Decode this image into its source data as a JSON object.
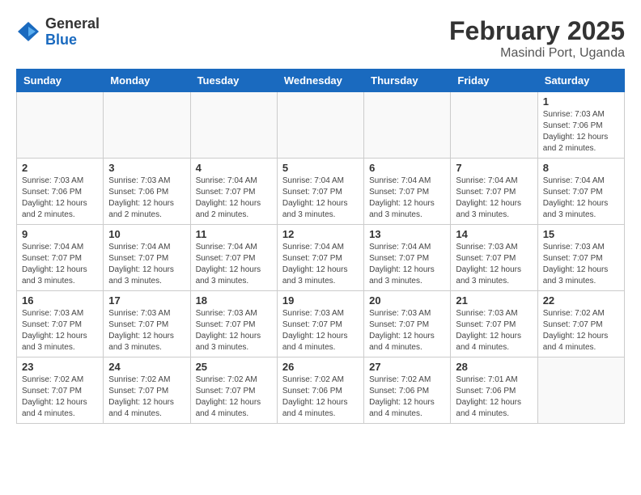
{
  "header": {
    "logo_general": "General",
    "logo_blue": "Blue",
    "title": "February 2025",
    "subtitle": "Masindi Port, Uganda"
  },
  "weekdays": [
    "Sunday",
    "Monday",
    "Tuesday",
    "Wednesday",
    "Thursday",
    "Friday",
    "Saturday"
  ],
  "weeks": [
    [
      {
        "day": null,
        "info": null
      },
      {
        "day": null,
        "info": null
      },
      {
        "day": null,
        "info": null
      },
      {
        "day": null,
        "info": null
      },
      {
        "day": null,
        "info": null
      },
      {
        "day": null,
        "info": null
      },
      {
        "day": "1",
        "info": "Sunrise: 7:03 AM\nSunset: 7:06 PM\nDaylight: 12 hours\nand 2 minutes."
      }
    ],
    [
      {
        "day": "2",
        "info": "Sunrise: 7:03 AM\nSunset: 7:06 PM\nDaylight: 12 hours\nand 2 minutes."
      },
      {
        "day": "3",
        "info": "Sunrise: 7:03 AM\nSunset: 7:06 PM\nDaylight: 12 hours\nand 2 minutes."
      },
      {
        "day": "4",
        "info": "Sunrise: 7:04 AM\nSunset: 7:07 PM\nDaylight: 12 hours\nand 2 minutes."
      },
      {
        "day": "5",
        "info": "Sunrise: 7:04 AM\nSunset: 7:07 PM\nDaylight: 12 hours\nand 3 minutes."
      },
      {
        "day": "6",
        "info": "Sunrise: 7:04 AM\nSunset: 7:07 PM\nDaylight: 12 hours\nand 3 minutes."
      },
      {
        "day": "7",
        "info": "Sunrise: 7:04 AM\nSunset: 7:07 PM\nDaylight: 12 hours\nand 3 minutes."
      },
      {
        "day": "8",
        "info": "Sunrise: 7:04 AM\nSunset: 7:07 PM\nDaylight: 12 hours\nand 3 minutes."
      }
    ],
    [
      {
        "day": "9",
        "info": "Sunrise: 7:04 AM\nSunset: 7:07 PM\nDaylight: 12 hours\nand 3 minutes."
      },
      {
        "day": "10",
        "info": "Sunrise: 7:04 AM\nSunset: 7:07 PM\nDaylight: 12 hours\nand 3 minutes."
      },
      {
        "day": "11",
        "info": "Sunrise: 7:04 AM\nSunset: 7:07 PM\nDaylight: 12 hours\nand 3 minutes."
      },
      {
        "day": "12",
        "info": "Sunrise: 7:04 AM\nSunset: 7:07 PM\nDaylight: 12 hours\nand 3 minutes."
      },
      {
        "day": "13",
        "info": "Sunrise: 7:04 AM\nSunset: 7:07 PM\nDaylight: 12 hours\nand 3 minutes."
      },
      {
        "day": "14",
        "info": "Sunrise: 7:03 AM\nSunset: 7:07 PM\nDaylight: 12 hours\nand 3 minutes."
      },
      {
        "day": "15",
        "info": "Sunrise: 7:03 AM\nSunset: 7:07 PM\nDaylight: 12 hours\nand 3 minutes."
      }
    ],
    [
      {
        "day": "16",
        "info": "Sunrise: 7:03 AM\nSunset: 7:07 PM\nDaylight: 12 hours\nand 3 minutes."
      },
      {
        "day": "17",
        "info": "Sunrise: 7:03 AM\nSunset: 7:07 PM\nDaylight: 12 hours\nand 3 minutes."
      },
      {
        "day": "18",
        "info": "Sunrise: 7:03 AM\nSunset: 7:07 PM\nDaylight: 12 hours\nand 3 minutes."
      },
      {
        "day": "19",
        "info": "Sunrise: 7:03 AM\nSunset: 7:07 PM\nDaylight: 12 hours\nand 4 minutes."
      },
      {
        "day": "20",
        "info": "Sunrise: 7:03 AM\nSunset: 7:07 PM\nDaylight: 12 hours\nand 4 minutes."
      },
      {
        "day": "21",
        "info": "Sunrise: 7:03 AM\nSunset: 7:07 PM\nDaylight: 12 hours\nand 4 minutes."
      },
      {
        "day": "22",
        "info": "Sunrise: 7:02 AM\nSunset: 7:07 PM\nDaylight: 12 hours\nand 4 minutes."
      }
    ],
    [
      {
        "day": "23",
        "info": "Sunrise: 7:02 AM\nSunset: 7:07 PM\nDaylight: 12 hours\nand 4 minutes."
      },
      {
        "day": "24",
        "info": "Sunrise: 7:02 AM\nSunset: 7:07 PM\nDaylight: 12 hours\nand 4 minutes."
      },
      {
        "day": "25",
        "info": "Sunrise: 7:02 AM\nSunset: 7:07 PM\nDaylight: 12 hours\nand 4 minutes."
      },
      {
        "day": "26",
        "info": "Sunrise: 7:02 AM\nSunset: 7:06 PM\nDaylight: 12 hours\nand 4 minutes."
      },
      {
        "day": "27",
        "info": "Sunrise: 7:02 AM\nSunset: 7:06 PM\nDaylight: 12 hours\nand 4 minutes."
      },
      {
        "day": "28",
        "info": "Sunrise: 7:01 AM\nSunset: 7:06 PM\nDaylight: 12 hours\nand 4 minutes."
      },
      {
        "day": null,
        "info": null
      }
    ]
  ]
}
